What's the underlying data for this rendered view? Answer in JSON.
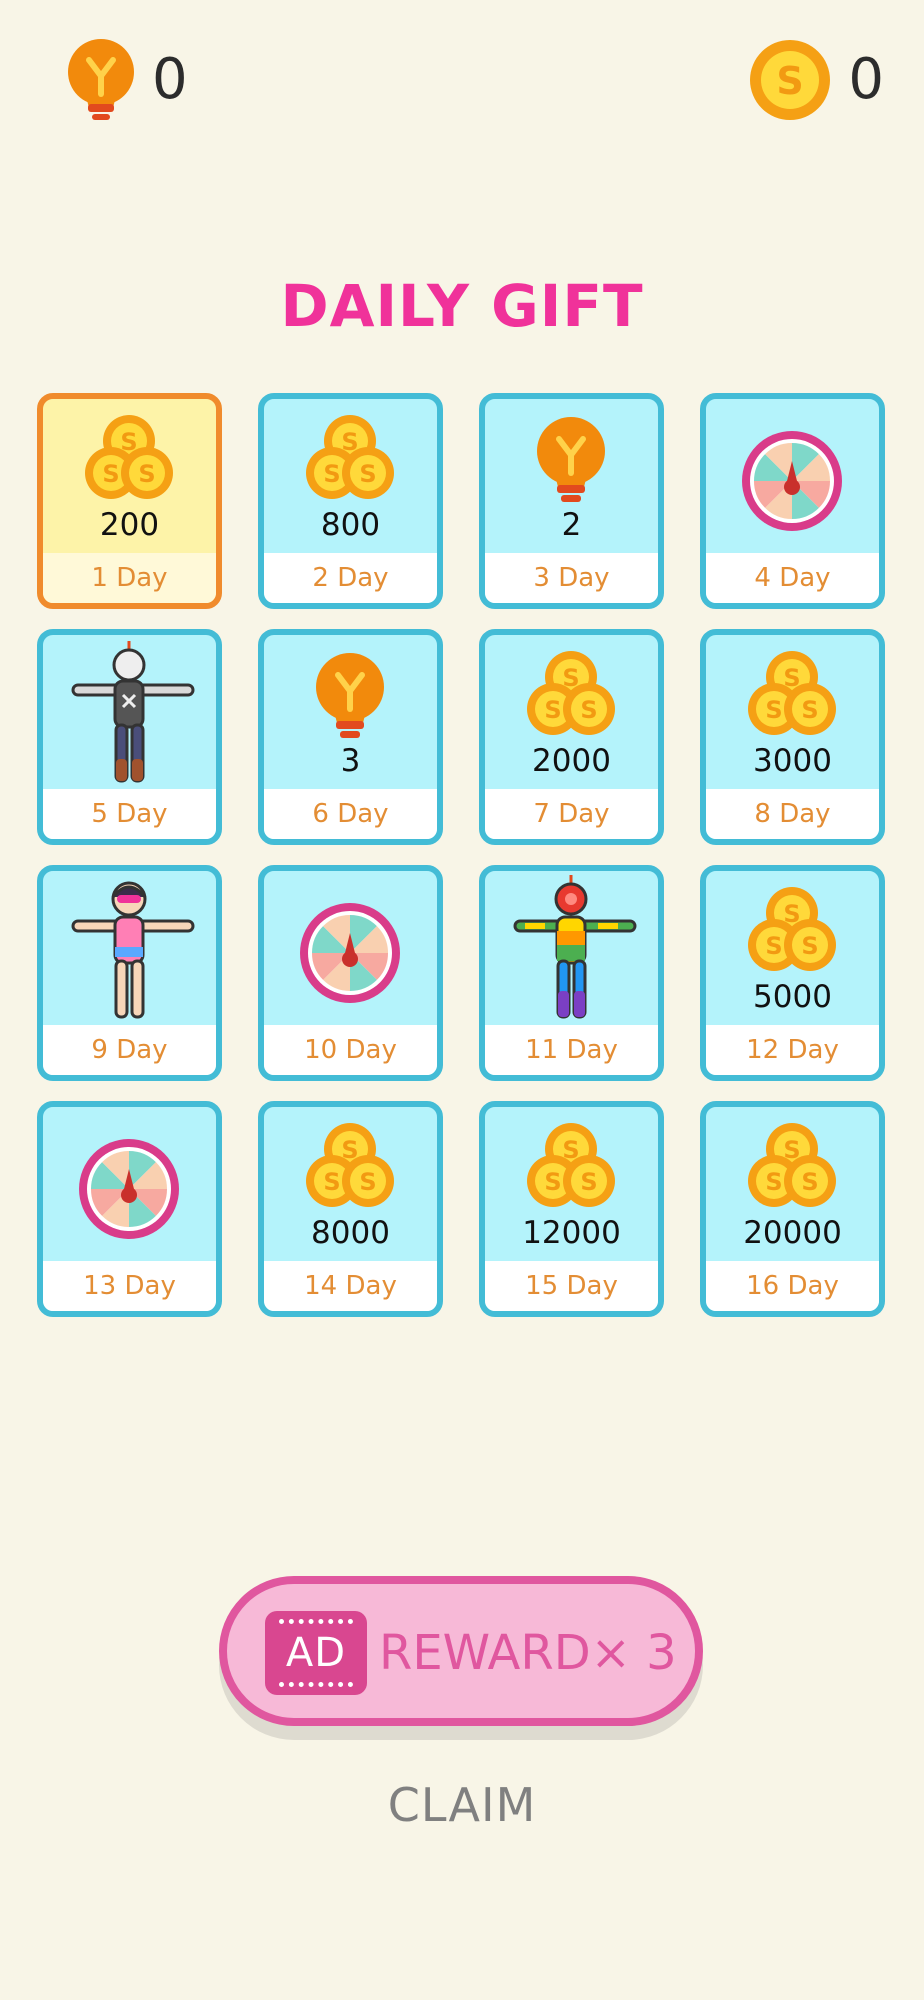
{
  "hud": {
    "hint_icon": "lightbulb-icon",
    "hint_count": "0",
    "coin_icon": "coin-icon",
    "coin_count": "0"
  },
  "title": "DAILY GIFT",
  "days": [
    {
      "day": "1 Day",
      "reward": "coins",
      "value": "200",
      "current": true
    },
    {
      "day": "2 Day",
      "reward": "coins",
      "value": "800"
    },
    {
      "day": "3 Day",
      "reward": "hint",
      "value": "2"
    },
    {
      "day": "4 Day",
      "reward": "spin-wheel",
      "value": ""
    },
    {
      "day": "5 Day",
      "reward": "skin-dark",
      "value": ""
    },
    {
      "day": "6 Day",
      "reward": "hint",
      "value": "3"
    },
    {
      "day": "7 Day",
      "reward": "coins",
      "value": "2000"
    },
    {
      "day": "8 Day",
      "reward": "coins",
      "value": "3000"
    },
    {
      "day": "9 Day",
      "reward": "skin-girl",
      "value": ""
    },
    {
      "day": "10 Day",
      "reward": "spin-wheel",
      "value": ""
    },
    {
      "day": "11 Day",
      "reward": "skin-rainbow",
      "value": ""
    },
    {
      "day": "12 Day",
      "reward": "coins",
      "value": "5000"
    },
    {
      "day": "13 Day",
      "reward": "spin-wheel",
      "value": ""
    },
    {
      "day": "14 Day",
      "reward": "coins",
      "value": "8000"
    },
    {
      "day": "15 Day",
      "reward": "coins",
      "value": "12000"
    },
    {
      "day": "16 Day",
      "reward": "coins",
      "value": "20000"
    }
  ],
  "reward_button": {
    "ad_label": "AD",
    "label": "REWARD× 3"
  },
  "claim_label": "CLAIM",
  "colors": {
    "background": "#f8f5e7",
    "title": "#f0329a",
    "card_border": "#43bcd6",
    "card_fill": "#b4f3fb",
    "current_border": "#f08b2c",
    "current_fill": "#fdf3a8",
    "day_text": "#e38d34",
    "reward_button": "#f7b9d7",
    "reward_text": "#e0579f"
  }
}
